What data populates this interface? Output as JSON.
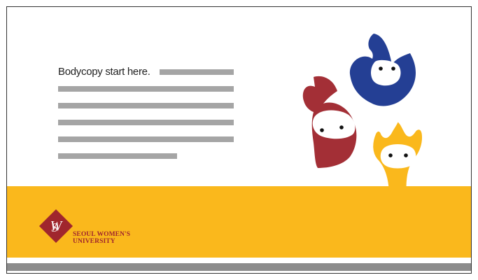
{
  "body_text": "Bodycopy start here.",
  "university": {
    "line1": "SEOUL WOMEN'S",
    "line2": "UNIVERSITY"
  },
  "colors": {
    "yellow": "#fab81c",
    "red": "#a32f36",
    "blue": "#243f94",
    "gray_line": "#a5a5a5",
    "gray_band": "#8c8c8c"
  }
}
